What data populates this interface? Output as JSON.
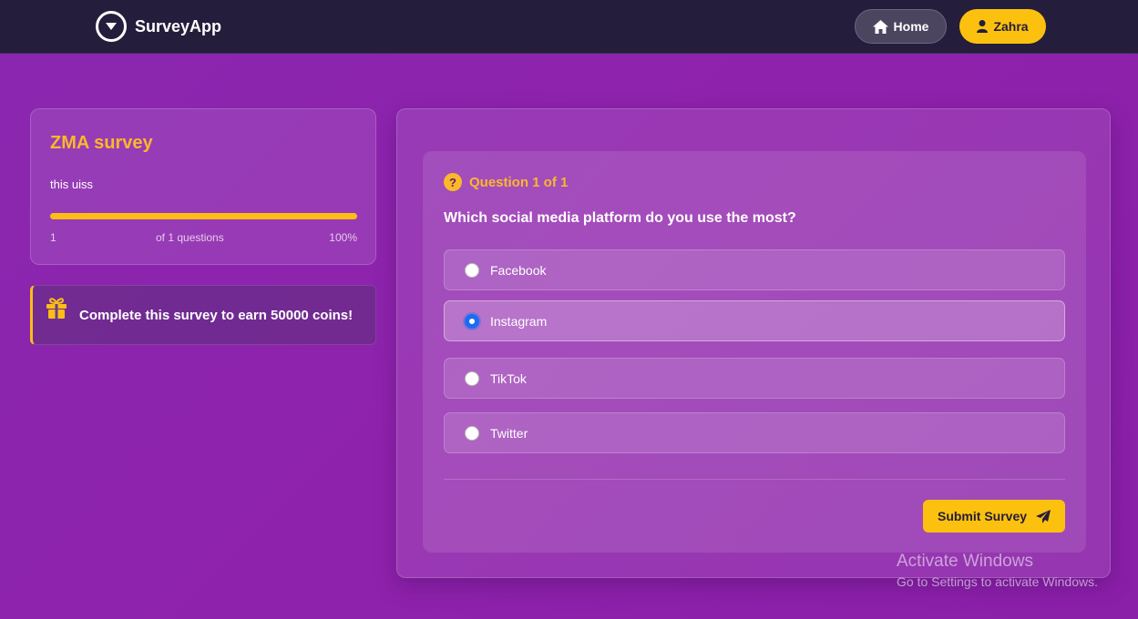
{
  "navbar": {
    "brand": "SurveyApp",
    "home_label": "Home",
    "user_label": "Zahra"
  },
  "survey": {
    "title": "ZMA survey",
    "description": "this uiss",
    "progress": {
      "current": "1",
      "label": "of 1 questions",
      "percent_label": "100%",
      "fraction": 1.0
    }
  },
  "reward": {
    "text": "Complete this survey to earn 50000 coins!"
  },
  "question": {
    "number_label": "Question 1 of 1",
    "text": "Which social media platform do you use the most?",
    "options": [
      {
        "label": "Facebook",
        "selected": false
      },
      {
        "label": "Instagram",
        "selected": true
      },
      {
        "label": "TikTok",
        "selected": false
      },
      {
        "label": "Twitter",
        "selected": false
      }
    ]
  },
  "submit_label": "Submit Survey",
  "watermark": {
    "title": "Activate Windows",
    "subtitle": "Go to Settings to activate Windows."
  },
  "colors": {
    "accent": "#fcc10f",
    "navbar": "#241d3b",
    "background": "#8a27b0",
    "radio_selected": "#1a6cf0"
  },
  "icons": [
    "logo-icon",
    "home-icon",
    "user-icon",
    "gift-icon",
    "question-icon",
    "send-icon"
  ]
}
